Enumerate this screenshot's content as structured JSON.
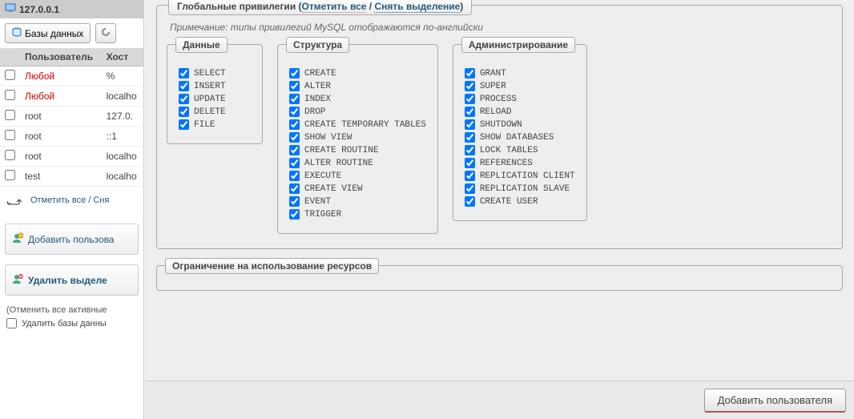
{
  "server": {
    "label": "127.0.0.1"
  },
  "sidebar": {
    "databases_btn": "Базы данных",
    "columns": {
      "user": "Пользователь",
      "host": "Хост"
    },
    "rows": [
      {
        "user": "Любой",
        "host": "%",
        "any": true
      },
      {
        "user": "Любой",
        "host": "localho",
        "any": true
      },
      {
        "user": "root",
        "host": "127.0.",
        "any": false
      },
      {
        "user": "root",
        "host": "::1",
        "any": false
      },
      {
        "user": "root",
        "host": "localho",
        "any": false
      },
      {
        "user": "test",
        "host": "localho",
        "any": false
      }
    ],
    "select_all": "Отметить все / Сня",
    "add_user": "Добавить пользова",
    "delete_header": "Удалить выделе",
    "delete_note": "(Отменить все активные",
    "delete_chk": "Удалить базы данны"
  },
  "privileges": {
    "legend_main": "Глобальные привилегии",
    "legend_check": "Отметить все",
    "legend_uncheck": "Снять выделение",
    "note": "Примечание: типы привилегий MySQL отображаются по-английски",
    "groups": [
      {
        "title": "Данные",
        "items": [
          "SELECT",
          "INSERT",
          "UPDATE",
          "DELETE",
          "FILE"
        ]
      },
      {
        "title": "Структура",
        "items": [
          "CREATE",
          "ALTER",
          "INDEX",
          "DROP",
          "CREATE TEMPORARY TABLES",
          "SHOW VIEW",
          "CREATE ROUTINE",
          "ALTER ROUTINE",
          "EXECUTE",
          "CREATE VIEW",
          "EVENT",
          "TRIGGER"
        ]
      },
      {
        "title": "Администрирование",
        "items": [
          "GRANT",
          "SUPER",
          "PROCESS",
          "RELOAD",
          "SHUTDOWN",
          "SHOW DATABASES",
          "LOCK TABLES",
          "REFERENCES",
          "REPLICATION CLIENT",
          "REPLICATION SLAVE",
          "CREATE USER"
        ]
      }
    ],
    "resources_legend": "Ограничение на использование ресурсов"
  },
  "buttons": {
    "add_user": "Добавить пользователя"
  }
}
